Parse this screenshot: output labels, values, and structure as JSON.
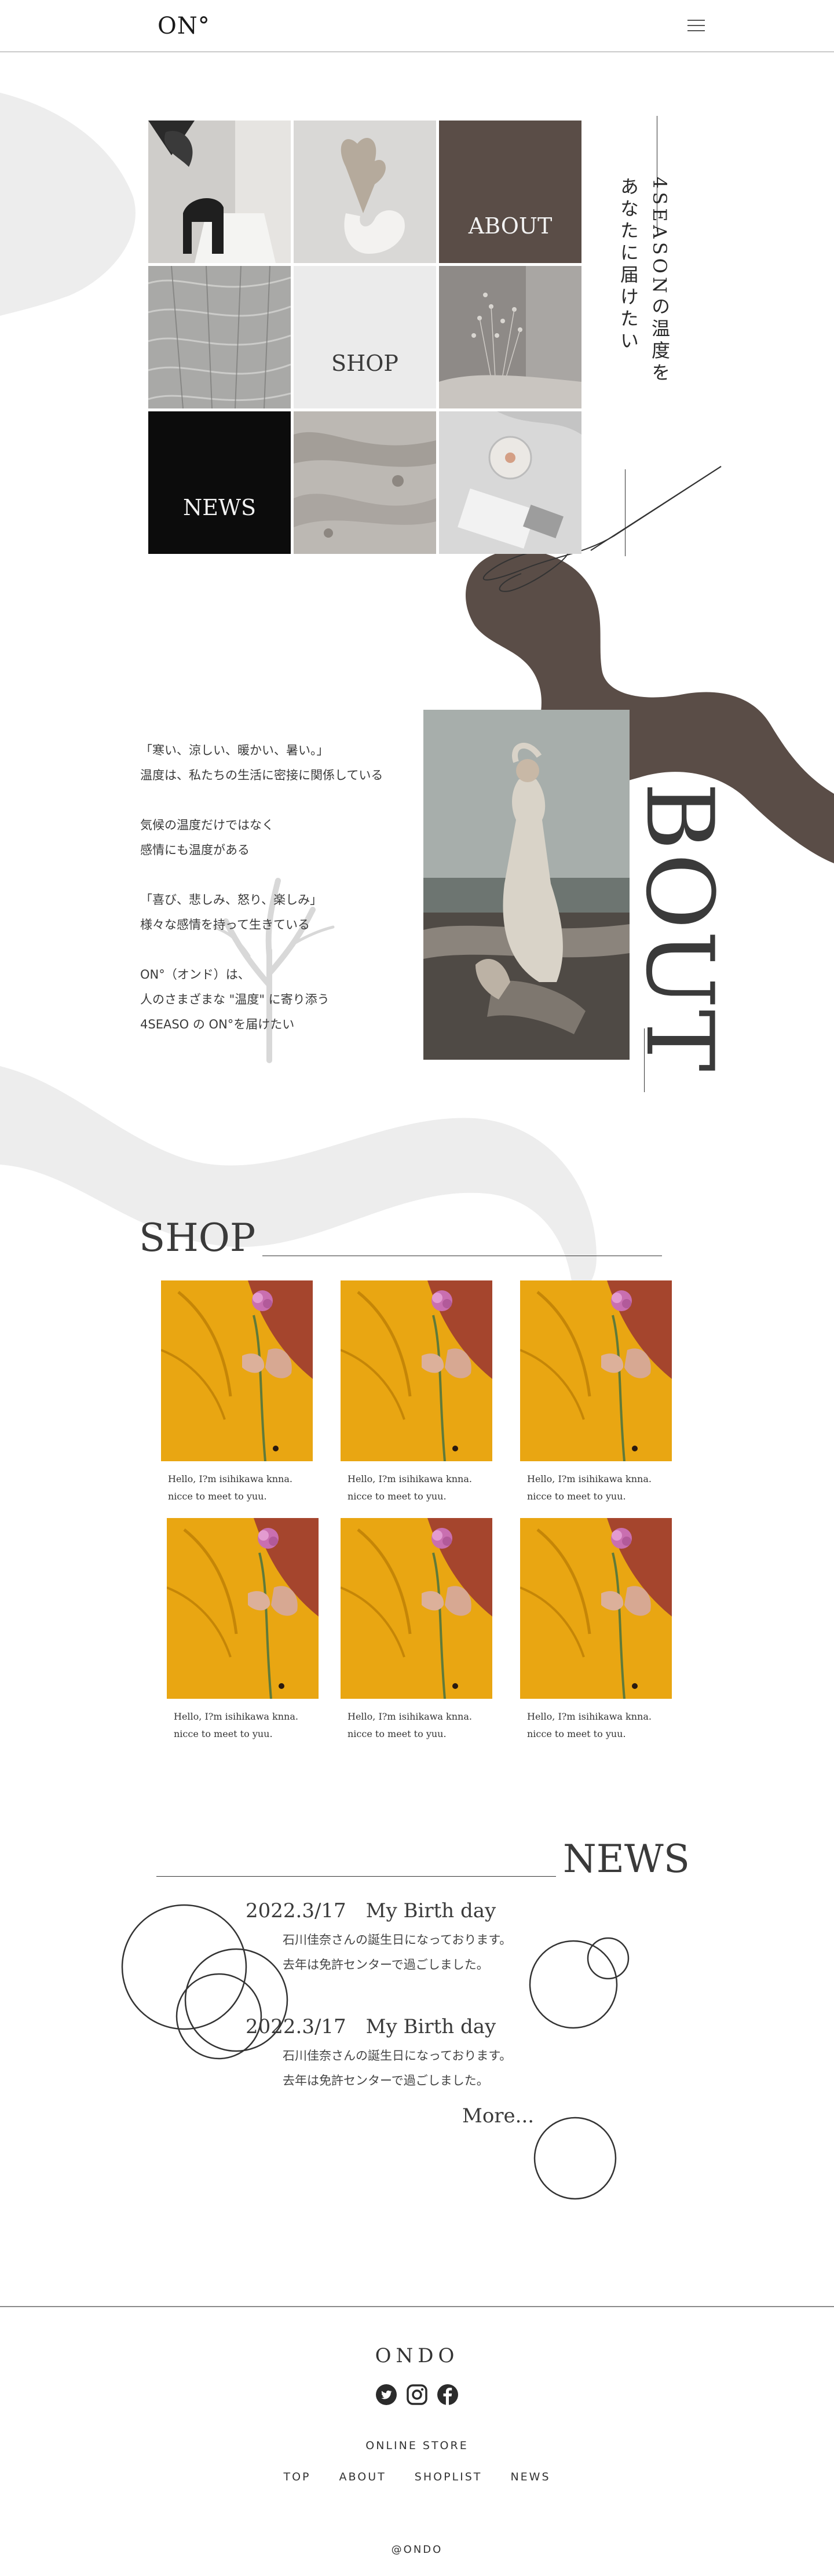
{
  "header": {
    "logo": "ON°",
    "menu_icon": "hamburger-menu-icon"
  },
  "hero": {
    "tiles": [
      "ABOUT",
      "SHOP",
      "NEWS"
    ],
    "vertical_text": [
      "4SEASONの温度を",
      "あなたに届けたい"
    ]
  },
  "about": {
    "paragraphs": [
      [
        "「寒い、涼しい、暖かい、暑い。」",
        "温度は、私たちの生活に密接に関係している"
      ],
      [
        "気候の温度だけではなく",
        "感情にも温度がある"
      ],
      [
        "「喜び、悲しみ、怒り、楽しみ」",
        "様々な感情を持って生きている"
      ],
      [
        "ON°（オンド）は、",
        "人のさまざまな \"温度\" に寄り添う",
        "4SEASO の ON°を届けたい"
      ]
    ],
    "word": "BOUT"
  },
  "shop": {
    "title": "SHOP",
    "cards": [
      {
        "line1": "Hello, I?m isihikawa knna.",
        "line2": "nicce to meet to yuu."
      },
      {
        "line1": "Hello, I?m isihikawa knna.",
        "line2": "nicce to meet to yuu."
      },
      {
        "line1": "Hello, I?m isihikawa knna.",
        "line2": "nicce to meet to yuu."
      },
      {
        "line1": "Hello, I?m isihikawa knna.",
        "line2": "nicce to meet to yuu."
      },
      {
        "line1": "Hello, I?m isihikawa knna.",
        "line2": "nicce to meet to yuu."
      },
      {
        "line1": "Hello, I?m isihikawa knna.",
        "line2": "nicce to meet to yuu."
      }
    ]
  },
  "news": {
    "title": "NEWS",
    "items": [
      {
        "date": "2022.3/17　My Birth day",
        "line1": "石川佳奈さんの誕生日になっております。",
        "line2": "去年は免許センターで過ごしました。"
      },
      {
        "date": "2022.3/17　My Birth day",
        "line1": "石川佳奈さんの誕生日になっております。",
        "line2": "去年は免許センターで過ごしました。"
      }
    ],
    "more": "More..."
  },
  "footer": {
    "logo": "ONDO",
    "social_icons": [
      "twitter-icon",
      "instagram-icon",
      "facebook-icon"
    ],
    "online_store": "ONLINE STORE",
    "nav": [
      "TOP",
      "ABOUT",
      "SHOPLIST",
      "NEWS"
    ],
    "copyright": "@ONDO"
  },
  "colors": {
    "accent_brown": "#5a4d47",
    "light_gray_shape": "#ededed",
    "mustard": "#e9a612",
    "rust": "#a5452d"
  }
}
